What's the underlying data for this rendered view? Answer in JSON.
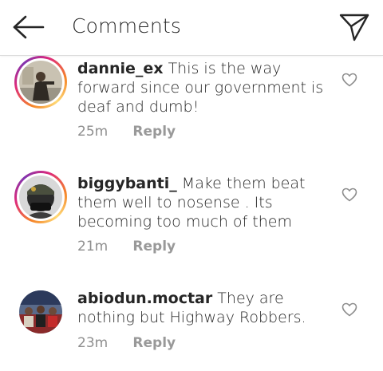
{
  "header": {
    "title": "Comments"
  },
  "comments": [
    {
      "username": "dannie_ex",
      "text": "This is the way forward since our government is deaf and dumb!",
      "time": "25m",
      "reply_label": "Reply"
    },
    {
      "username": "biggybanti_",
      "text": "Make them beat them well to nosense . Its becoming too much of them",
      "time": "21m",
      "reply_label": "Reply"
    },
    {
      "username": "abiodun.moctar",
      "text": "They are nothing but Highway Robbers.",
      "time": "23m",
      "reply_label": "Reply"
    }
  ]
}
